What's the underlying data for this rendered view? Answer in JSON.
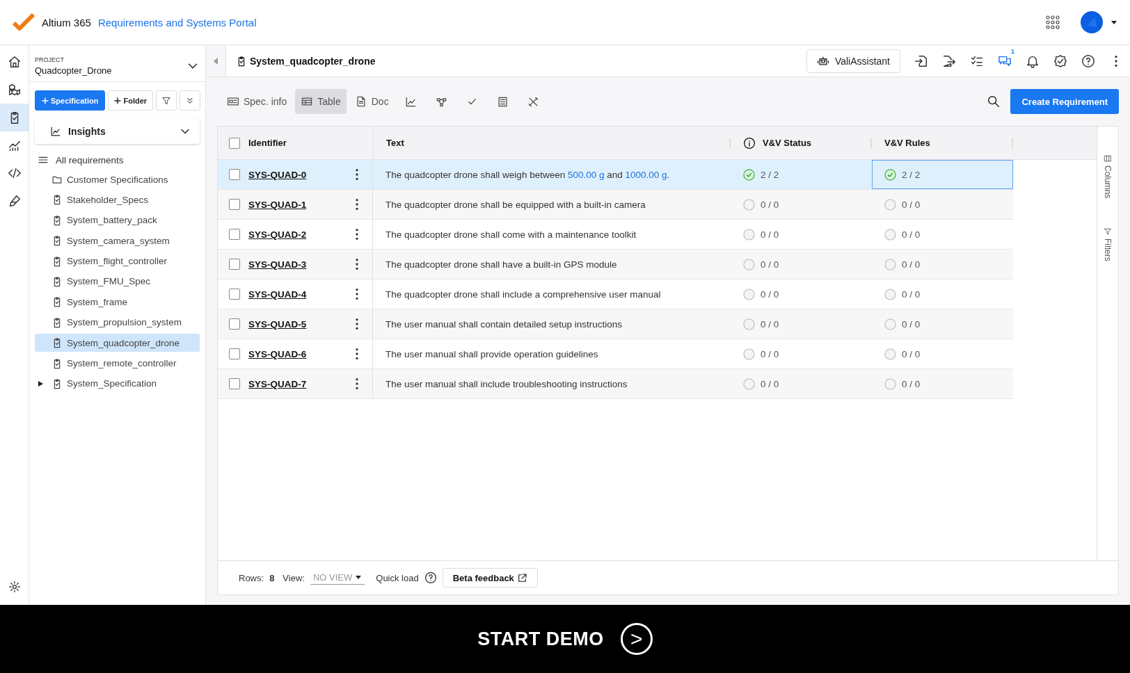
{
  "topbar": {
    "brand": "Altium 365",
    "portal": "Requirements and Systems Portal"
  },
  "rail": [
    {
      "selected": false
    },
    {
      "selected": false
    },
    {
      "selected": true
    },
    {
      "selected": false
    },
    {
      "selected": false
    },
    {
      "selected": false
    }
  ],
  "sidebar": {
    "project_label": "PROJECT",
    "project": "Quadcopter_Drone",
    "new_spec": "Specification",
    "new_folder": "Folder",
    "insights": "Insights",
    "all": "All requirements",
    "items": [
      {
        "kind": "folder",
        "label": "Customer Specifications",
        "selected": false,
        "expandable": false
      },
      {
        "kind": "spec",
        "label": "Stakeholder_Specs",
        "selected": false,
        "expandable": false
      },
      {
        "kind": "spec",
        "label": "System_battery_pack",
        "selected": false,
        "expandable": false
      },
      {
        "kind": "spec",
        "label": "System_camera_system",
        "selected": false,
        "expandable": false
      },
      {
        "kind": "spec",
        "label": "System_flight_controller",
        "selected": false,
        "expandable": false
      },
      {
        "kind": "spec",
        "label": "System_FMU_Spec",
        "selected": false,
        "expandable": false
      },
      {
        "kind": "spec",
        "label": "System_frame",
        "selected": false,
        "expandable": false
      },
      {
        "kind": "spec",
        "label": "System_propulsion_system",
        "selected": false,
        "expandable": false
      },
      {
        "kind": "spec",
        "label": "System_quadcopter_drone",
        "selected": true,
        "expandable": false
      },
      {
        "kind": "spec",
        "label": "System_remote_controller",
        "selected": false,
        "expandable": false
      },
      {
        "kind": "spec",
        "label": "System_Specification",
        "selected": false,
        "expandable": true
      }
    ]
  },
  "header": {
    "title": "System_quadcopter_drone",
    "assistant": "ValiAssistant",
    "chat_badge": "1"
  },
  "view_tabs": [
    {
      "label": "Spec. info",
      "selected": false
    },
    {
      "label": "Table",
      "selected": true
    },
    {
      "label": "Doc",
      "selected": false
    }
  ],
  "create_button": "Create Requirement",
  "table": {
    "select_all_checked": false,
    "columns": [
      "Identifier",
      "Text",
      "V&V Status",
      "V&V Rules"
    ],
    "rows": [
      {
        "id": "SYS-QUAD-0",
        "selected": true,
        "text": [
          {
            "t": "The quadcopter drone shall weigh between ",
            "value": false
          },
          {
            "t": "500.00  g",
            "value": true
          },
          {
            "t": " and ",
            "value": false
          },
          {
            "t": "1000.00  g",
            "value": true
          },
          {
            "t": ".",
            "value": false
          }
        ],
        "status": "2 / 2",
        "status_passed": true,
        "rules": "2 / 2",
        "rules_passed": true
      },
      {
        "id": "SYS-QUAD-1",
        "selected": false,
        "text": [
          {
            "t": "The quadcopter drone shall be equipped with a built-in camera",
            "value": false
          }
        ],
        "status": "0 / 0",
        "status_passed": false,
        "rules": "0 / 0",
        "rules_passed": false
      },
      {
        "id": "SYS-QUAD-2",
        "selected": false,
        "text": [
          {
            "t": "The quadcopter drone shall come with a maintenance toolkit",
            "value": false
          }
        ],
        "status": "0 / 0",
        "status_passed": false,
        "rules": "0 / 0",
        "rules_passed": false
      },
      {
        "id": "SYS-QUAD-3",
        "selected": false,
        "text": [
          {
            "t": "The quadcopter drone shall have a built-in GPS module",
            "value": false
          }
        ],
        "status": "0 / 0",
        "status_passed": false,
        "rules": "0 / 0",
        "rules_passed": false
      },
      {
        "id": "SYS-QUAD-4",
        "selected": false,
        "text": [
          {
            "t": "The quadcopter drone shall include a comprehensive user manual",
            "value": false
          }
        ],
        "status": "0 / 0",
        "status_passed": false,
        "rules": "0 / 0",
        "rules_passed": false
      },
      {
        "id": "SYS-QUAD-5",
        "selected": false,
        "text": [
          {
            "t": "The user manual shall contain detailed setup instructions",
            "value": false
          }
        ],
        "status": "0 / 0",
        "status_passed": false,
        "rules": "0 / 0",
        "rules_passed": false
      },
      {
        "id": "SYS-QUAD-6",
        "selected": false,
        "text": [
          {
            "t": "The user manual shall provide operation guidelines",
            "value": false
          }
        ],
        "status": "0 / 0",
        "status_passed": false,
        "rules": "0 / 0",
        "rules_passed": false
      },
      {
        "id": "SYS-QUAD-7",
        "selected": false,
        "text": [
          {
            "t": "The user manual shall include troubleshooting instructions",
            "value": false
          }
        ],
        "status": "0 / 0",
        "status_passed": false,
        "rules": "0 / 0",
        "rules_passed": false
      }
    ]
  },
  "side_panel": [
    "Columns",
    "Filters"
  ],
  "footer": {
    "rows_label": "Rows:",
    "rows": "8",
    "view_label": "View:",
    "view": "NO VIEW",
    "quick_load": "Quick load",
    "feedback": "Beta feedback"
  },
  "demo": {
    "label": "START DEMO",
    "symbol": ">"
  }
}
